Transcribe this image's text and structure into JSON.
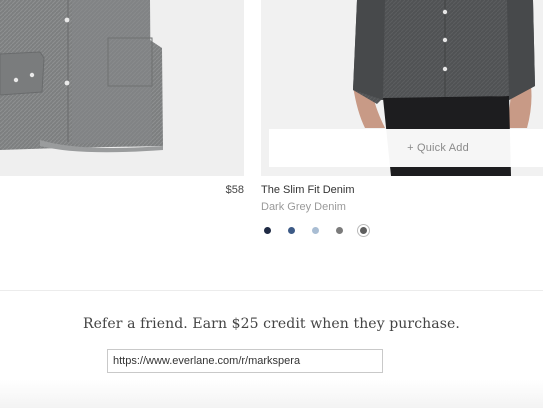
{
  "products": [
    {
      "price": "$58",
      "image": "shirt-flatlay"
    },
    {
      "name": "The Slim Fit Denim",
      "color": "Dark Grey Denim",
      "image": "model-wearing-shirt",
      "quick_add_label": "+ Quick Add",
      "swatches": [
        {
          "color": "#1f2a44"
        },
        {
          "color": "#3d5a86"
        },
        {
          "color": "#a9bdd3"
        },
        {
          "color": "#7b7b7b"
        },
        {
          "color": "#5e5e5e",
          "selected": true
        }
      ]
    }
  ],
  "referral": {
    "message": "Refer a friend. Earn $25 credit when they purchase.",
    "link": "https://www.everlane.com/r/markspera"
  }
}
